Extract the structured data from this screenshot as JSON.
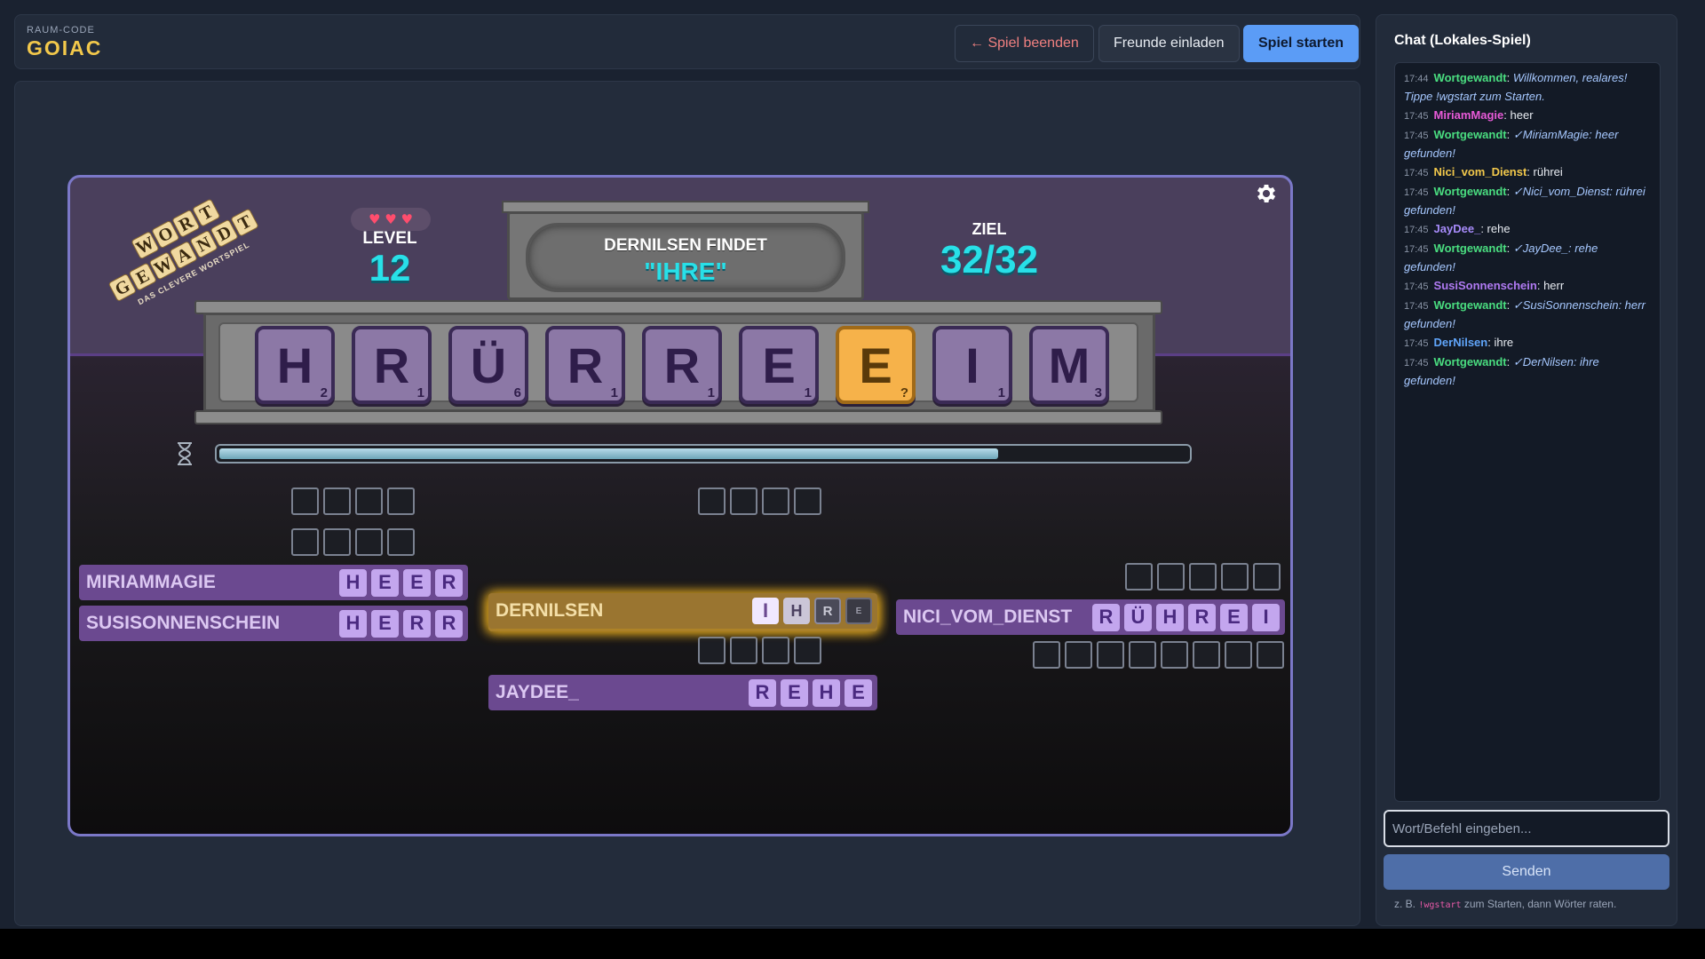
{
  "header": {
    "brand_small": "RAUM-CODE",
    "brand_big": "GOIAC",
    "btn_end": "← Spiel beenden",
    "btn_invite": "Freunde einladen",
    "btn_start": "Spiel starten"
  },
  "game": {
    "logo": {
      "line1": "WORT",
      "line2": "GEWANDT",
      "tagline": "DAS CLEVERE WORTSPIEL"
    },
    "hearts": "♥ ♥ ♥",
    "level_label": "LEVEL",
    "level_value": "12",
    "ziel_label": "ZIEL",
    "ziel_value": "32/32",
    "finder_text": "DERNILSEN FINDET",
    "found_word": "\"IHRE\"",
    "timer_fraction": 0.805,
    "tiles": [
      {
        "letter": "H",
        "points": "2",
        "joker": false
      },
      {
        "letter": "R",
        "points": "1",
        "joker": false
      },
      {
        "letter": "Ü",
        "points": "6",
        "joker": false
      },
      {
        "letter": "R",
        "points": "1",
        "joker": false
      },
      {
        "letter": "R",
        "points": "1",
        "joker": false
      },
      {
        "letter": "E",
        "points": "1",
        "joker": false
      },
      {
        "letter": "E",
        "points": "?",
        "joker": true
      },
      {
        "letter": "I",
        "points": "1",
        "joker": false
      },
      {
        "letter": "M",
        "points": "3",
        "joker": false
      }
    ],
    "players": {
      "miriam": {
        "name": "MIRIAMMAGIE",
        "letters": [
          "H",
          "E",
          "E",
          "R"
        ]
      },
      "susi": {
        "name": "SUSISONNENSCHEIN",
        "letters": [
          "H",
          "E",
          "R",
          "R"
        ]
      },
      "nilsen": {
        "name": "DERNILSEN",
        "letters": [
          "I",
          "H",
          "R",
          "E"
        ]
      },
      "jaydee": {
        "name": "JAYDEE_",
        "letters": [
          "R",
          "E",
          "H",
          "E"
        ]
      },
      "nici": {
        "name": "NICI_VOM_DIENST",
        "letters": [
          "R",
          "Ü",
          "H",
          "R",
          "E",
          "I"
        ]
      }
    }
  },
  "chat": {
    "title": "Chat (Lokales-Spiel)",
    "messages": [
      {
        "time": "17:44",
        "user": "Wortgewandt",
        "color": "#4ade80",
        "text": "Willkommen, realares! Tippe !wgstart zum Starten.",
        "bot": true
      },
      {
        "time": "17:45",
        "user": "MiriamMagie",
        "color": "#e85ad8",
        "text": "heer",
        "bot": false
      },
      {
        "time": "17:45",
        "user": "Wortgewandt",
        "color": "#4ade80",
        "text": "✓MiriamMagie: heer gefunden!",
        "bot": true
      },
      {
        "time": "17:45",
        "user": "Nici_vom_Dienst",
        "color": "#f2c84b",
        "text": "rührei",
        "bot": false
      },
      {
        "time": "17:45",
        "user": "Wortgewandt",
        "color": "#4ade80",
        "text": "✓Nici_vom_Dienst: rührei gefunden!",
        "bot": true
      },
      {
        "time": "17:45",
        "user": "JayDee_",
        "color": "#a78bfa",
        "text": "rehe",
        "bot": false
      },
      {
        "time": "17:45",
        "user": "Wortgewandt",
        "color": "#4ade80",
        "text": "✓JayDee_: rehe gefunden!",
        "bot": true
      },
      {
        "time": "17:45",
        "user": "SusiSonnenschein",
        "color": "#b07af2",
        "text": "herr",
        "bot": false
      },
      {
        "time": "17:45",
        "user": "Wortgewandt",
        "color": "#4ade80",
        "text": "✓SusiSonnenschein: herr gefunden!",
        "bot": true
      },
      {
        "time": "17:45",
        "user": "DerNilsen",
        "color": "#60a5fa",
        "text": "ihre",
        "bot": false
      },
      {
        "time": "17:45",
        "user": "Wortgewandt",
        "color": "#4ade80",
        "text": "✓DerNilsen: ihre gefunden!",
        "bot": true
      }
    ],
    "input_placeholder": "Wort/Befehl eingeben...",
    "send_label": "Senden",
    "hint_prefix": "z. B.",
    "hint_code": "!wgstart",
    "hint_suffix": "zum Starten, dann Wörter raten."
  }
}
